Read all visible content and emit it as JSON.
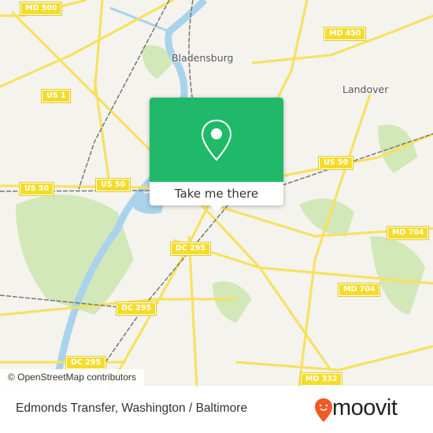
{
  "map": {
    "road_labels": [
      "MD 500",
      "MD 450",
      "US 1",
      "US 50",
      "US 50",
      "US 50",
      "DC 295",
      "DC 295",
      "DC 295",
      "MD 704",
      "MD 704",
      "MD 332"
    ],
    "place_labels": [
      "Bladensburg",
      "Landover"
    ],
    "colors": {
      "land": "#f4f3ee",
      "road": "#f7e15a",
      "water": "#a9d3ea",
      "park": "#cfe6b0",
      "rail": "#777777"
    },
    "attribution": "© OpenStreetMap contributors"
  },
  "popup": {
    "icon": "map-pin-icon",
    "button_label": "Take me there",
    "color": "#20b96a"
  },
  "footer": {
    "title": "Edmonds Transfer, Washington / Baltimore",
    "logo_text": "moovit",
    "logo_color": "#f05a28"
  }
}
